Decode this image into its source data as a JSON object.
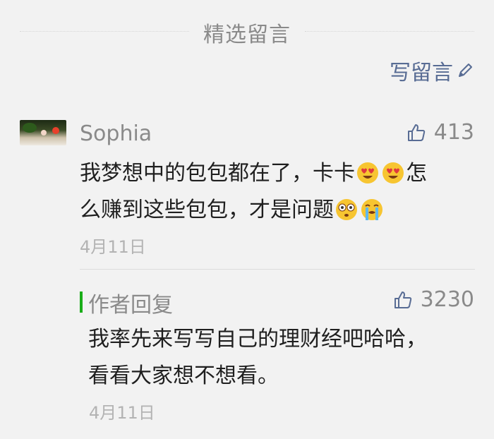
{
  "section": {
    "title": "精选留言"
  },
  "write_comment": {
    "label": "写留言",
    "icon": "pencil-icon",
    "color": "#586c94"
  },
  "comment": {
    "author": "Sophia",
    "likes": "413",
    "content_line1_a": "我梦想中的包包都在了，卡卡",
    "content_line1_b": "怎",
    "content_line2_a": "么赚到这些包包，才是问题",
    "emojis": [
      "heart-eyes-emoji",
      "heart-eyes-emoji",
      "flushed-emoji",
      "crying-emoji"
    ],
    "date": "4月11日"
  },
  "reply": {
    "author": "作者回复",
    "likes": "3230",
    "content_line1": "我率先来写写自己的理财经吧哈哈，",
    "content_line2": "看看大家想不想看。",
    "date": "4月11日",
    "accent": "#1aad19"
  }
}
